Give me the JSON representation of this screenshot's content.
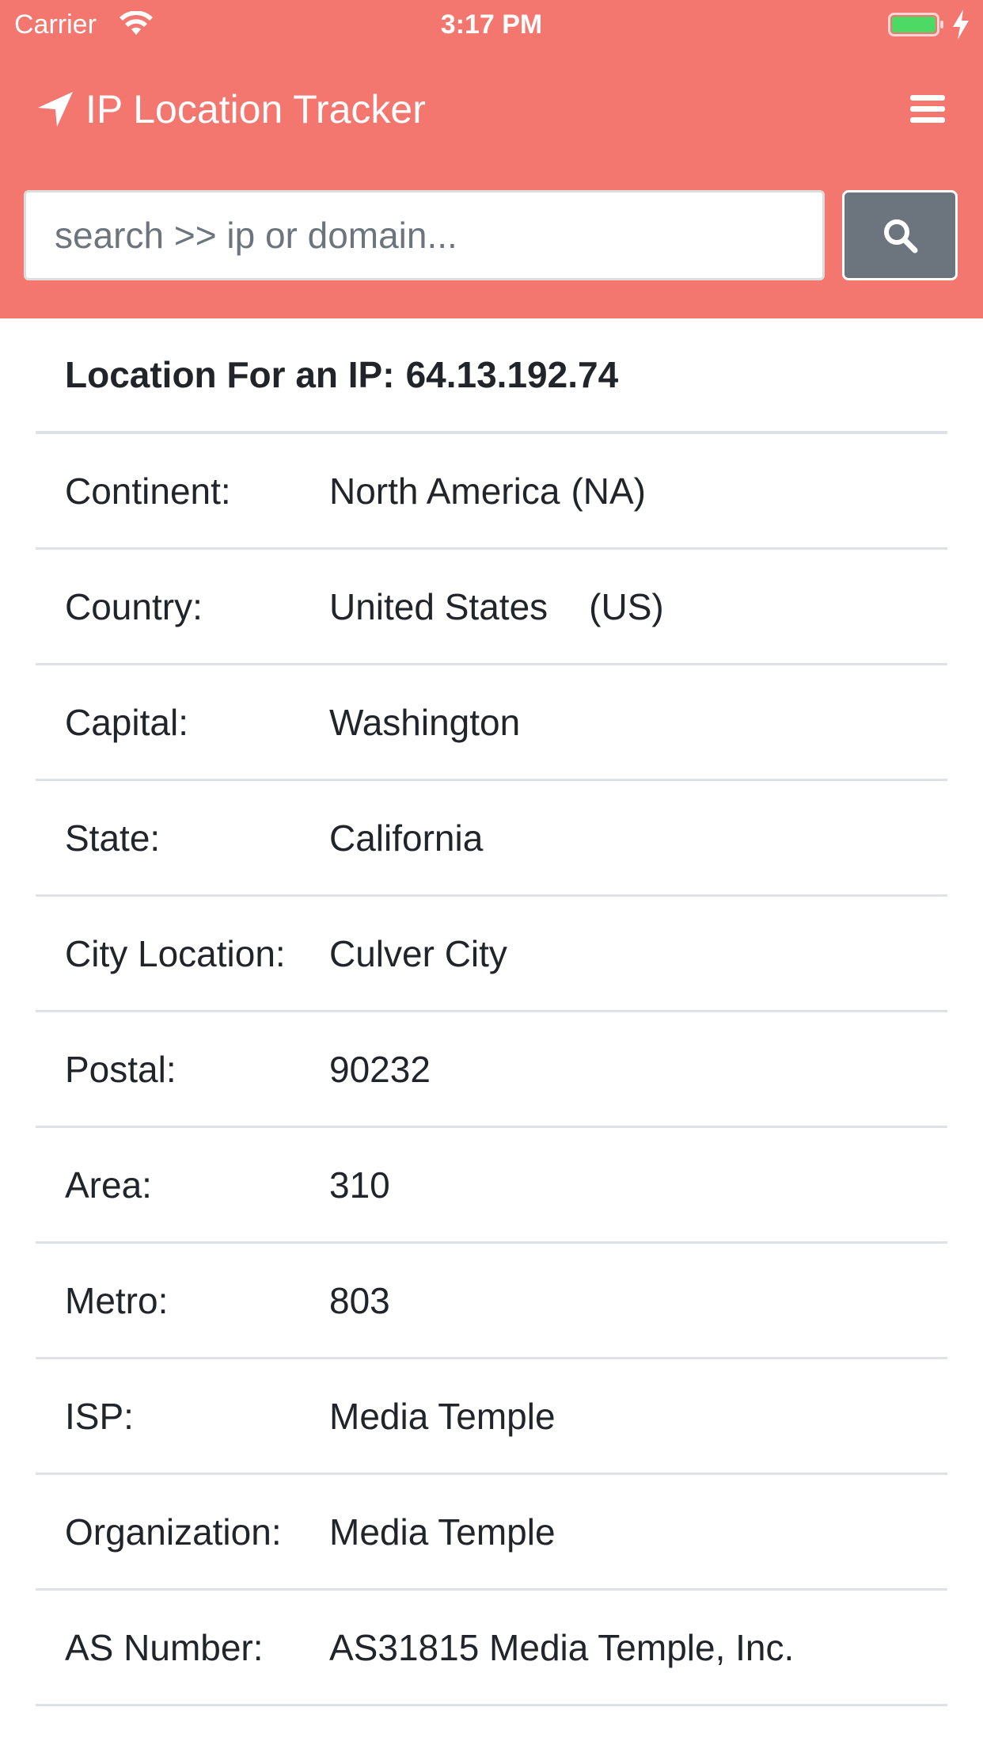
{
  "status_bar": {
    "carrier": "Carrier",
    "time": "3:17 PM",
    "battery_color": "#4cd964"
  },
  "navbar": {
    "title": "IP Location Tracker",
    "brand_icon": "location-arrow-icon",
    "menu_icon": "hamburger-menu-icon",
    "background_color": "#f3766f"
  },
  "search": {
    "placeholder": "search >> ip or domain...",
    "value": "",
    "button_icon": "search-icon",
    "button_color": "#6c757d"
  },
  "result": {
    "heading_label": "Location For an IP:",
    "ip": "64.13.192.74",
    "rows": [
      {
        "label": "Continent:",
        "value": "North America",
        "code": "(NA)"
      },
      {
        "label": "Country:",
        "value": "United States",
        "code": "(US)"
      },
      {
        "label": "Capital:",
        "value": "Washington"
      },
      {
        "label": "State:",
        "value": "California"
      },
      {
        "label": "City Location:",
        "value": "Culver City"
      },
      {
        "label": "Postal:",
        "value": "90232"
      },
      {
        "label": "Area:",
        "value": "310"
      },
      {
        "label": "Metro:",
        "value": "803"
      },
      {
        "label": "ISP:",
        "value": "Media Temple"
      },
      {
        "label": "Organization:",
        "value": "Media Temple"
      },
      {
        "label": "AS Number:",
        "value": "AS31815 Media Temple, Inc."
      }
    ]
  }
}
